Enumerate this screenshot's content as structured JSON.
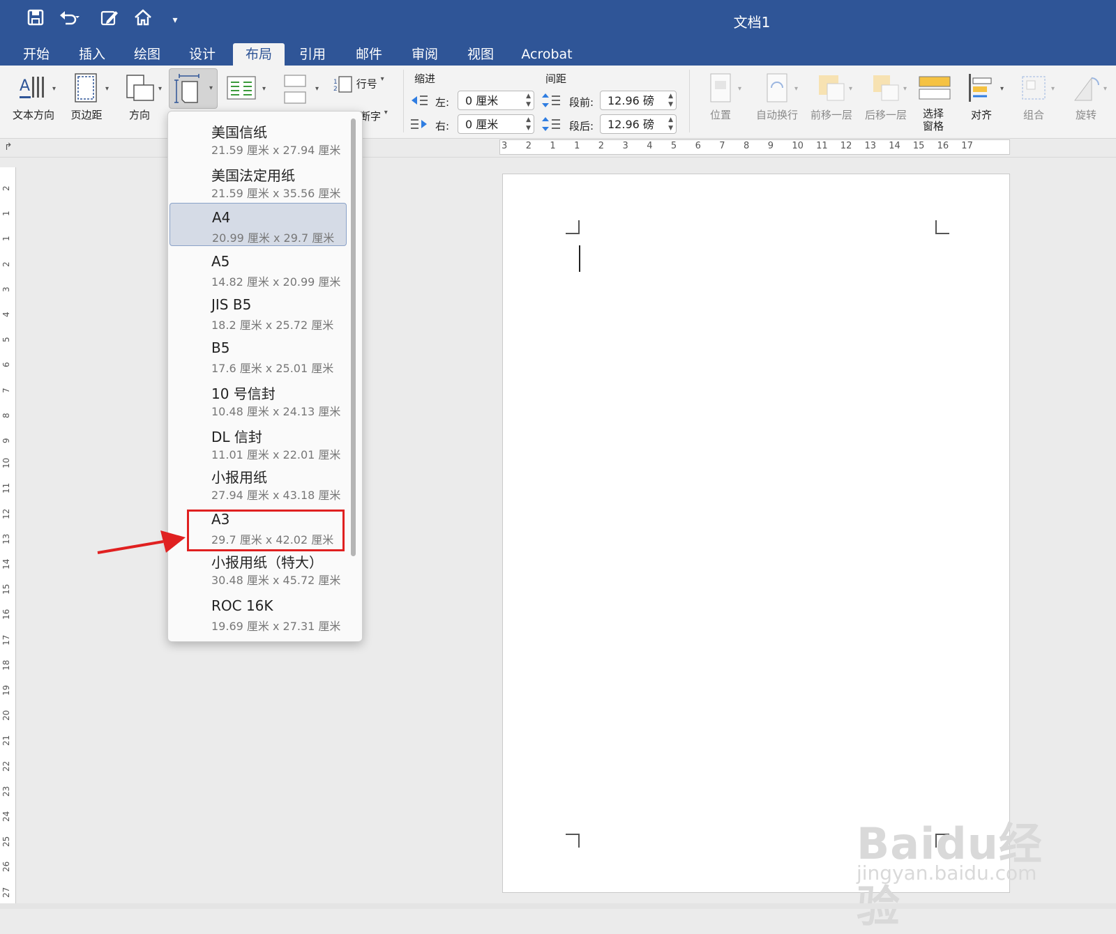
{
  "window": {
    "title": "文档1"
  },
  "tabs": [
    {
      "label": "开始"
    },
    {
      "label": "插入"
    },
    {
      "label": "绘图"
    },
    {
      "label": "设计"
    },
    {
      "label": "布局",
      "active": true
    },
    {
      "label": "引用"
    },
    {
      "label": "邮件"
    },
    {
      "label": "审阅"
    },
    {
      "label": "视图"
    },
    {
      "label": "Acrobat"
    }
  ],
  "ribbon": {
    "text_direction": "文本方向",
    "margins": "页边距",
    "orientation": "方向",
    "line_numbers": "行号",
    "hyphenation": "断字",
    "indent": {
      "title": "缩进",
      "left_label": "左:",
      "left_value": "0 厘米",
      "right_label": "右:",
      "right_value": "0 厘米"
    },
    "spacing": {
      "title": "间距",
      "before_label": "段前:",
      "before_value": "12.96 磅",
      "after_label": "段后:",
      "after_value": "12.96 磅"
    },
    "position": "位置",
    "wrap_text": "自动换行",
    "bring_forward": "前移一层",
    "send_backward": "后移一层",
    "selection_pane_line1": "选择",
    "selection_pane_line2": "窗格",
    "align": "对齐",
    "group": "组合",
    "rotate": "旋转"
  },
  "ruler": {
    "h_ticks": [
      "3",
      "2",
      "1",
      "1",
      "2",
      "3",
      "4",
      "5",
      "6",
      "7",
      "8",
      "9",
      "10",
      "11",
      "12",
      "13",
      "14",
      "15",
      "16",
      "17"
    ],
    "v_ticks": [
      "2",
      "1",
      "1",
      "2",
      "3",
      "4",
      "5",
      "6",
      "7",
      "8",
      "9",
      "10",
      "11",
      "12",
      "13",
      "14",
      "15",
      "16",
      "17",
      "18",
      "19",
      "20",
      "21",
      "22",
      "23",
      "24",
      "25",
      "26",
      "27"
    ]
  },
  "paper_sizes": {
    "selected": "A4",
    "highlighted": "A3",
    "items": [
      {
        "name": "美国信纸",
        "size": "21.59 厘米 x 27.94 厘米"
      },
      {
        "name": "美国法定用纸",
        "size": "21.59 厘米 x 35.56 厘米"
      },
      {
        "name": "A4",
        "size": "20.99 厘米 x 29.7 厘米"
      },
      {
        "name": "A5",
        "size": "14.82 厘米 x 20.99 厘米"
      },
      {
        "name": "JIS B5",
        "size": "18.2 厘米 x 25.72 厘米"
      },
      {
        "name": "B5",
        "size": "17.6 厘米 x 25.01 厘米"
      },
      {
        "name": "10 号信封",
        "size": "10.48 厘米 x 24.13 厘米"
      },
      {
        "name": "DL 信封",
        "size": "11.01 厘米 x 22.01 厘米"
      },
      {
        "name": "小报用纸",
        "size": "27.94 厘米 x 43.18 厘米"
      },
      {
        "name": "A3",
        "size": "29.7 厘米 x 42.02 厘米"
      },
      {
        "name": "小报用纸（特大）",
        "size": "30.48 厘米 x 45.72 厘米"
      },
      {
        "name": "ROC 16K",
        "size": "19.69 厘米 x 27.31 厘米"
      }
    ]
  },
  "watermark": {
    "text": "Baidu经验",
    "sub": "jingyan.baidu.com"
  },
  "colors": {
    "brand": "#2f5597",
    "highlight": "#e02020",
    "selected_bg": "#d5dbe6"
  }
}
